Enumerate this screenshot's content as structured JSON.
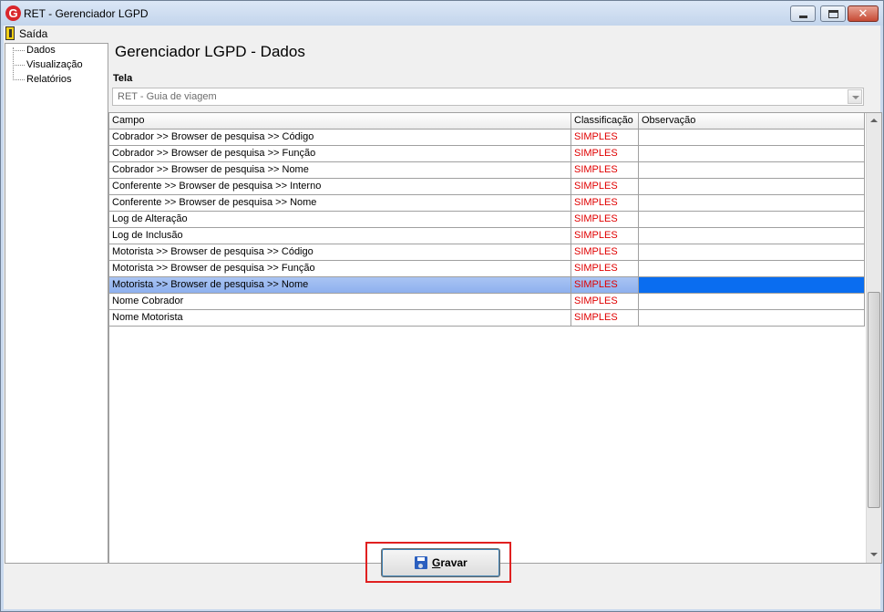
{
  "window": {
    "title": "RET - Gerenciador LGPD",
    "icon_letter": "G",
    "controls": {
      "minimize": "minimize-icon",
      "maximize": "maximize-icon",
      "close": "✕"
    }
  },
  "menu": {
    "items": [
      {
        "label": "Saída",
        "icon": "exit-door-icon"
      }
    ]
  },
  "sidebar": {
    "items": [
      {
        "label": "Dados"
      },
      {
        "label": "Visualização"
      },
      {
        "label": "Relatórios"
      }
    ]
  },
  "main": {
    "title": "Gerenciador LGPD - Dados",
    "tela_label": "Tela",
    "tela_value": "RET - Guia de viagem"
  },
  "grid": {
    "columns": [
      "Campo",
      "Classificação",
      "Observação"
    ],
    "rows": [
      {
        "campo": "Cobrador >> Browser de pesquisa >> Código",
        "classificacao": "SIMPLES",
        "observacao": ""
      },
      {
        "campo": "Cobrador >> Browser de pesquisa >> Função",
        "classificacao": "SIMPLES",
        "observacao": ""
      },
      {
        "campo": "Cobrador >> Browser de pesquisa >> Nome",
        "classificacao": "SIMPLES",
        "observacao": ""
      },
      {
        "campo": "Conferente >> Browser de pesquisa >> Interno",
        "classificacao": "SIMPLES",
        "observacao": ""
      },
      {
        "campo": "Conferente >> Browser de pesquisa >> Nome",
        "classificacao": "SIMPLES",
        "observacao": ""
      },
      {
        "campo": "Log de Alteração",
        "classificacao": "SIMPLES",
        "observacao": ""
      },
      {
        "campo": "Log de Inclusão",
        "classificacao": "SIMPLES",
        "observacao": ""
      },
      {
        "campo": "Motorista >> Browser de pesquisa >> Código",
        "classificacao": "SIMPLES",
        "observacao": ""
      },
      {
        "campo": "Motorista >> Browser de pesquisa >> Função",
        "classificacao": "SIMPLES",
        "observacao": ""
      },
      {
        "campo": "Motorista >> Browser de pesquisa >> Nome",
        "classificacao": "SIMPLES",
        "observacao": "",
        "selected": true
      },
      {
        "campo": "Nome Cobrador",
        "classificacao": "SIMPLES",
        "observacao": ""
      },
      {
        "campo": "Nome Motorista",
        "classificacao": "SIMPLES",
        "observacao": ""
      }
    ]
  },
  "footer": {
    "save_label": "Gravar",
    "save_icon": "floppy-disk-icon"
  },
  "colors": {
    "classification_text": "#e00000",
    "selected_row": "#0a6df0",
    "highlight_border": "#e02020"
  }
}
